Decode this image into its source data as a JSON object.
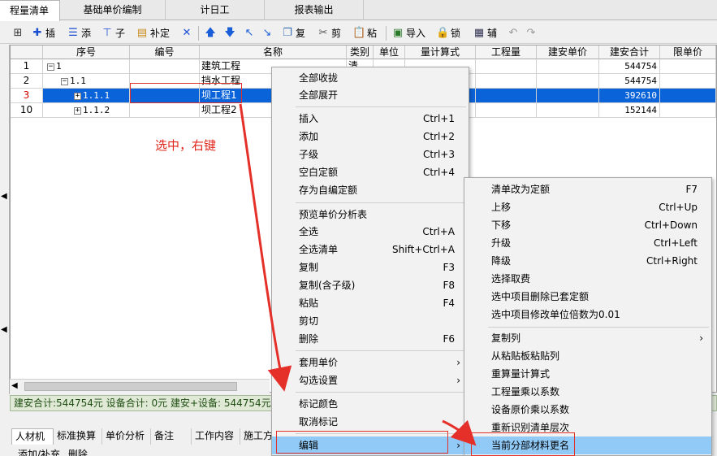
{
  "tabs": [
    "程量清单",
    "基础单价编制",
    "计日工",
    "报表输出"
  ],
  "toolbar": {
    "insert": "插",
    "add": "添",
    "child": "子",
    "fill_quota": "补定",
    "copy": "复",
    "cut": "剪",
    "paste": "粘",
    "import": "导入",
    "lock": "锁",
    "aux": "辅"
  },
  "grid": {
    "columns": [
      "序号",
      "编号",
      "名称",
      "类别",
      "单位",
      "量计算式",
      "工程量",
      "建安单价",
      "建安合计",
      "限单价"
    ],
    "rows": [
      {
        "row": "1",
        "seq": "1",
        "name": "建筑工程",
        "type": "清",
        "total": "544754"
      },
      {
        "row": "2",
        "seq": "1.1",
        "name": "挡水工程",
        "type": "",
        "total": "544754"
      },
      {
        "row": "3",
        "seq": "1.1.1",
        "name": "坝工程1",
        "type": "",
        "total": "392610"
      },
      {
        "row": "10",
        "seq": "1.1.2",
        "name": "坝工程2",
        "type": "",
        "total": "152144"
      }
    ]
  },
  "annotation": "选中，右键",
  "status_text": "建安合计:544754元 设备合计: 0元 建安+设备: 544754元",
  "bottom_tabs": [
    "人材机",
    "标准换算",
    "单价分析",
    "备注",
    "工作内容",
    "施工方"
  ],
  "bottom_sub": [
    "添加/补充",
    "删除"
  ],
  "context_menu": {
    "items": [
      {
        "label": "全部收拢",
        "shortcut": ""
      },
      {
        "label": "全部展开",
        "shortcut": ""
      },
      {
        "label": "插入",
        "shortcut": "Ctrl+1"
      },
      {
        "label": "添加",
        "shortcut": "Ctrl+2"
      },
      {
        "label": "子级",
        "shortcut": "Ctrl+3"
      },
      {
        "label": "空白定额",
        "shortcut": "Ctrl+4"
      },
      {
        "label": "存为自编定额",
        "shortcut": ""
      },
      {
        "label": "预览单价分析表",
        "shortcut": ""
      },
      {
        "label": "全选",
        "shortcut": "Ctrl+A"
      },
      {
        "label": "全选清单",
        "shortcut": "Shift+Ctrl+A"
      },
      {
        "label": "复制",
        "shortcut": "F3"
      },
      {
        "label": "复制(含子级)",
        "shortcut": "F8"
      },
      {
        "label": "粘贴",
        "shortcut": "F4"
      },
      {
        "label": "剪切",
        "shortcut": ""
      },
      {
        "label": "删除",
        "shortcut": "F6"
      },
      {
        "label": "套用单价",
        "shortcut": ""
      },
      {
        "label": "勾选设置",
        "shortcut": ""
      },
      {
        "label": "标记颜色",
        "shortcut": ""
      },
      {
        "label": "取消标记",
        "shortcut": ""
      },
      {
        "label": "编辑",
        "shortcut": ""
      }
    ],
    "submenu_arrow": "›"
  },
  "sub_menu": {
    "items": [
      {
        "label": "清单改为定额",
        "shortcut": "F7"
      },
      {
        "label": "上移",
        "shortcut": "Ctrl+Up"
      },
      {
        "label": "下移",
        "shortcut": "Ctrl+Down"
      },
      {
        "label": "升级",
        "shortcut": "Ctrl+Left"
      },
      {
        "label": "降级",
        "shortcut": "Ctrl+Right"
      },
      {
        "label": "选择取费",
        "shortcut": ""
      },
      {
        "label": "选中项目删除已套定额",
        "shortcut": ""
      },
      {
        "label": "选中项目修改单位倍数为0.01",
        "shortcut": ""
      },
      {
        "label": "复制列",
        "shortcut": ""
      },
      {
        "label": "从粘贴板粘贴列",
        "shortcut": ""
      },
      {
        "label": "重算量计算式",
        "shortcut": ""
      },
      {
        "label": "工程量乘以系数",
        "shortcut": ""
      },
      {
        "label": "设备原价乘以系数",
        "shortcut": ""
      },
      {
        "label": "重新识别清单层次",
        "shortcut": ""
      },
      {
        "label": "当前分部材料更名",
        "shortcut": ""
      }
    ]
  },
  "colors": {
    "selection": "#0a63d8",
    "menu_highlight": "#91c9f7",
    "annotation_red": "#e5302a",
    "status_bg": "#dfe9d6"
  }
}
